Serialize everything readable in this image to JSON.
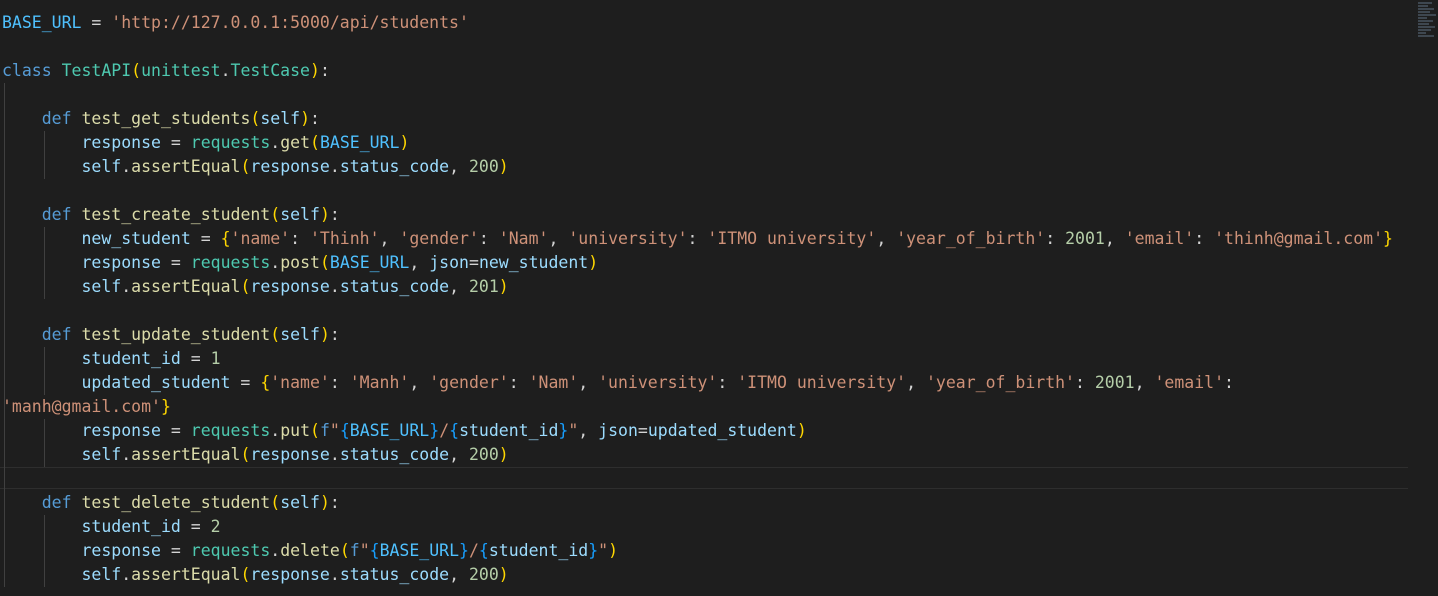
{
  "editor": {
    "theme": "dark",
    "colors": {
      "background": "#1e1e1e",
      "default": "#d4d4d4",
      "keyword": "#569cd6",
      "class": "#4ec9b0",
      "function": "#dcdcaa",
      "variable": "#9cdcfe",
      "constant": "#4fc1ff",
      "string": "#ce9178",
      "number": "#b5cea8",
      "bracket1": "#ffd700",
      "bracket2": "#da70d6",
      "bracket3": "#179fff"
    },
    "code": {
      "lines": [
        [
          [
            "BASE_URL",
            "constant"
          ],
          [
            " = ",
            "default"
          ],
          [
            "'http://127.0.0.1:5000/api/students'",
            "string"
          ]
        ],
        [],
        [
          [
            "class",
            "keyword"
          ],
          [
            " ",
            "default"
          ],
          [
            "TestAPI",
            "class"
          ],
          [
            "(",
            "bracket1"
          ],
          [
            "unittest",
            "class"
          ],
          [
            ".",
            "default"
          ],
          [
            "TestCase",
            "class"
          ],
          [
            ")",
            "bracket1"
          ],
          [
            ":",
            "default"
          ]
        ],
        [],
        [
          [
            "    ",
            "default"
          ],
          [
            "def",
            "keyword"
          ],
          [
            " ",
            "default"
          ],
          [
            "test_get_students",
            "function"
          ],
          [
            "(",
            "bracket1"
          ],
          [
            "self",
            "variable"
          ],
          [
            ")",
            "bracket1"
          ],
          [
            ":",
            "default"
          ]
        ],
        [
          [
            "        ",
            "default"
          ],
          [
            "response",
            "variable"
          ],
          [
            " = ",
            "default"
          ],
          [
            "requests",
            "class"
          ],
          [
            ".",
            "default"
          ],
          [
            "get",
            "function"
          ],
          [
            "(",
            "bracket1"
          ],
          [
            "BASE_URL",
            "constant"
          ],
          [
            ")",
            "bracket1"
          ]
        ],
        [
          [
            "        ",
            "default"
          ],
          [
            "self",
            "variable"
          ],
          [
            ".",
            "default"
          ],
          [
            "assertEqual",
            "function"
          ],
          [
            "(",
            "bracket1"
          ],
          [
            "response",
            "variable"
          ],
          [
            ".",
            "default"
          ],
          [
            "status_code",
            "variable"
          ],
          [
            ", ",
            "default"
          ],
          [
            "200",
            "number"
          ],
          [
            ")",
            "bracket1"
          ]
        ],
        [],
        [
          [
            "    ",
            "default"
          ],
          [
            "def",
            "keyword"
          ],
          [
            " ",
            "default"
          ],
          [
            "test_create_student",
            "function"
          ],
          [
            "(",
            "bracket1"
          ],
          [
            "self",
            "variable"
          ],
          [
            ")",
            "bracket1"
          ],
          [
            ":",
            "default"
          ]
        ],
        [
          [
            "        ",
            "default"
          ],
          [
            "new_student",
            "variable"
          ],
          [
            " = ",
            "default"
          ],
          [
            "{",
            "bracket1"
          ],
          [
            "'name'",
            "string"
          ],
          [
            ": ",
            "default"
          ],
          [
            "'Thinh'",
            "string"
          ],
          [
            ", ",
            "default"
          ],
          [
            "'gender'",
            "string"
          ],
          [
            ": ",
            "default"
          ],
          [
            "'Nam'",
            "string"
          ],
          [
            ", ",
            "default"
          ],
          [
            "'university'",
            "string"
          ],
          [
            ": ",
            "default"
          ],
          [
            "'ITMO university'",
            "string"
          ],
          [
            ", ",
            "default"
          ],
          [
            "'year_of_birth'",
            "string"
          ],
          [
            ": ",
            "default"
          ],
          [
            "2001",
            "number"
          ],
          [
            ", ",
            "default"
          ],
          [
            "'email'",
            "string"
          ],
          [
            ": ",
            "default"
          ],
          [
            "'thinh@gmail.com'",
            "string"
          ],
          [
            "}",
            "bracket1"
          ]
        ],
        [
          [
            "        ",
            "default"
          ],
          [
            "response",
            "variable"
          ],
          [
            " = ",
            "default"
          ],
          [
            "requests",
            "class"
          ],
          [
            ".",
            "default"
          ],
          [
            "post",
            "function"
          ],
          [
            "(",
            "bracket1"
          ],
          [
            "BASE_URL",
            "constant"
          ],
          [
            ", ",
            "default"
          ],
          [
            "json",
            "variable"
          ],
          [
            "=",
            "default"
          ],
          [
            "new_student",
            "variable"
          ],
          [
            ")",
            "bracket1"
          ]
        ],
        [
          [
            "        ",
            "default"
          ],
          [
            "self",
            "variable"
          ],
          [
            ".",
            "default"
          ],
          [
            "assertEqual",
            "function"
          ],
          [
            "(",
            "bracket1"
          ],
          [
            "response",
            "variable"
          ],
          [
            ".",
            "default"
          ],
          [
            "status_code",
            "variable"
          ],
          [
            ", ",
            "default"
          ],
          [
            "201",
            "number"
          ],
          [
            ")",
            "bracket1"
          ]
        ],
        [],
        [
          [
            "    ",
            "default"
          ],
          [
            "def",
            "keyword"
          ],
          [
            " ",
            "default"
          ],
          [
            "test_update_student",
            "function"
          ],
          [
            "(",
            "bracket1"
          ],
          [
            "self",
            "variable"
          ],
          [
            ")",
            "bracket1"
          ],
          [
            ":",
            "default"
          ]
        ],
        [
          [
            "        ",
            "default"
          ],
          [
            "student_id",
            "variable"
          ],
          [
            " = ",
            "default"
          ],
          [
            "1",
            "number"
          ]
        ],
        [
          [
            "        ",
            "default"
          ],
          [
            "updated_student",
            "variable"
          ],
          [
            " = ",
            "default"
          ],
          [
            "{",
            "bracket1"
          ],
          [
            "'name'",
            "string"
          ],
          [
            ": ",
            "default"
          ],
          [
            "'Manh'",
            "string"
          ],
          [
            ", ",
            "default"
          ],
          [
            "'gender'",
            "string"
          ],
          [
            ": ",
            "default"
          ],
          [
            "'Nam'",
            "string"
          ],
          [
            ", ",
            "default"
          ],
          [
            "'university'",
            "string"
          ],
          [
            ": ",
            "default"
          ],
          [
            "'ITMO university'",
            "string"
          ],
          [
            ", ",
            "default"
          ],
          [
            "'year_of_birth'",
            "string"
          ],
          [
            ": ",
            "default"
          ],
          [
            "2001",
            "number"
          ],
          [
            ", ",
            "default"
          ],
          [
            "'email'",
            "string"
          ],
          [
            ":",
            "default"
          ]
        ],
        [
          [
            "'manh@gmail.com'",
            "string"
          ],
          [
            "}",
            "bracket1"
          ]
        ],
        [
          [
            "        ",
            "default"
          ],
          [
            "response",
            "variable"
          ],
          [
            " = ",
            "default"
          ],
          [
            "requests",
            "class"
          ],
          [
            ".",
            "default"
          ],
          [
            "put",
            "function"
          ],
          [
            "(",
            "bracket1"
          ],
          [
            "f",
            "keyword"
          ],
          [
            "\"",
            "string"
          ],
          [
            "{",
            "bracket3"
          ],
          [
            "BASE_URL",
            "constant"
          ],
          [
            "}",
            "bracket3"
          ],
          [
            "/",
            "string"
          ],
          [
            "{",
            "bracket3"
          ],
          [
            "student_id",
            "variable"
          ],
          [
            "}",
            "bracket3"
          ],
          [
            "\"",
            "string"
          ],
          [
            ", ",
            "default"
          ],
          [
            "json",
            "variable"
          ],
          [
            "=",
            "default"
          ],
          [
            "updated_student",
            "variable"
          ],
          [
            ")",
            "bracket1"
          ]
        ],
        [
          [
            "        ",
            "default"
          ],
          [
            "self",
            "variable"
          ],
          [
            ".",
            "default"
          ],
          [
            "assertEqual",
            "function"
          ],
          [
            "(",
            "bracket1"
          ],
          [
            "response",
            "variable"
          ],
          [
            ".",
            "default"
          ],
          [
            "status_code",
            "variable"
          ],
          [
            ", ",
            "default"
          ],
          [
            "200",
            "number"
          ],
          [
            ")",
            "bracket1"
          ]
        ],
        [],
        [
          [
            "    ",
            "default"
          ],
          [
            "def",
            "keyword"
          ],
          [
            " ",
            "default"
          ],
          [
            "test_delete_student",
            "function"
          ],
          [
            "(",
            "bracket1"
          ],
          [
            "self",
            "variable"
          ],
          [
            ")",
            "bracket1"
          ],
          [
            ":",
            "default"
          ]
        ],
        [
          [
            "        ",
            "default"
          ],
          [
            "student_id",
            "variable"
          ],
          [
            " = ",
            "default"
          ],
          [
            "2",
            "number"
          ]
        ],
        [
          [
            "        ",
            "default"
          ],
          [
            "response",
            "variable"
          ],
          [
            " = ",
            "default"
          ],
          [
            "requests",
            "class"
          ],
          [
            ".",
            "default"
          ],
          [
            "delete",
            "function"
          ],
          [
            "(",
            "bracket1"
          ],
          [
            "f",
            "keyword"
          ],
          [
            "\"",
            "string"
          ],
          [
            "{",
            "bracket3"
          ],
          [
            "BASE_URL",
            "constant"
          ],
          [
            "}",
            "bracket3"
          ],
          [
            "/",
            "string"
          ],
          [
            "{",
            "bracket3"
          ],
          [
            "student_id",
            "variable"
          ],
          [
            "}",
            "bracket3"
          ],
          [
            "\"",
            "string"
          ],
          [
            ")",
            "bracket1"
          ]
        ],
        [
          [
            "        ",
            "default"
          ],
          [
            "self",
            "variable"
          ],
          [
            ".",
            "default"
          ],
          [
            "assertEqual",
            "function"
          ],
          [
            "(",
            "bracket1"
          ],
          [
            "response",
            "variable"
          ],
          [
            ".",
            "default"
          ],
          [
            "status_code",
            "variable"
          ],
          [
            ", ",
            "default"
          ],
          [
            "200",
            "number"
          ],
          [
            ")",
            "bracket1"
          ]
        ]
      ]
    }
  }
}
